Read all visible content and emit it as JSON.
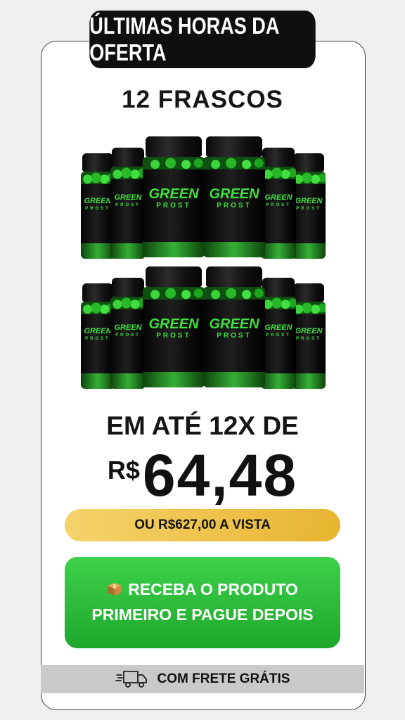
{
  "banner": {
    "text": "ÚLTIMAS HORAS DA OFERTA"
  },
  "offer": {
    "quantity": "12 FRASCOS"
  },
  "product": {
    "brand": "GREEN",
    "brand_sub": "PROST",
    "bottles_shown": 12
  },
  "pricing": {
    "installment_intro": "EM ATÉ 12X DE",
    "currency": "R$",
    "installment_value": "64,48",
    "cash_price": "OU R$627,00 A VISTA"
  },
  "cta": {
    "line1": "RECEBA O PRODUTO",
    "line2": "PRIMEIRO E PAGUE DEPOIS",
    "icon": "package-icon"
  },
  "shipping": {
    "text": "COM FRETE GRÁTIS",
    "icon": "truck-icon"
  },
  "colors": {
    "background": "#efefef",
    "banner": "#0f0f0f",
    "cash_badge_start": "#f5d36a",
    "cash_badge_end": "#e8b431",
    "cta_green": "#2bbd38",
    "shipping_bar": "#c9c9c9",
    "brand_green": "#3ee03e"
  }
}
